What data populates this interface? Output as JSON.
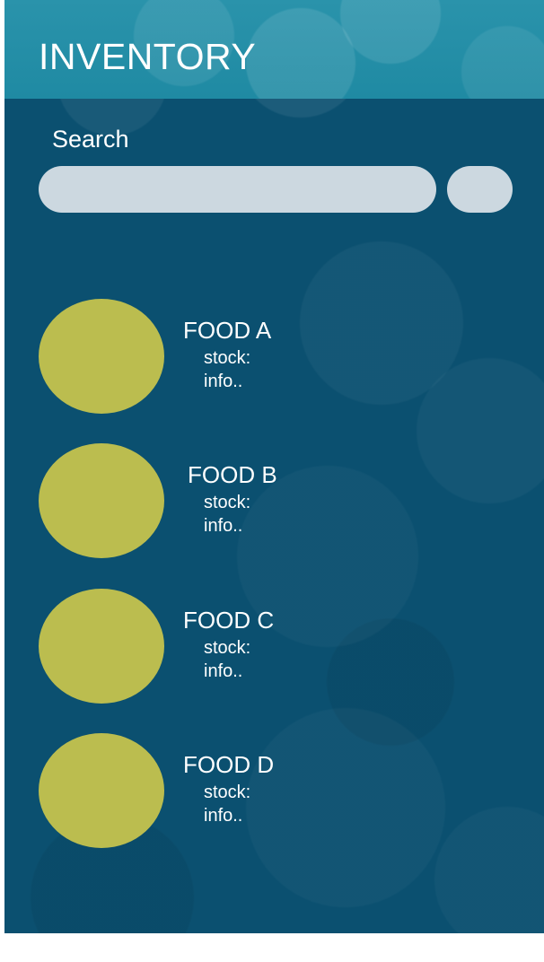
{
  "header": {
    "title": "INVENTORY"
  },
  "search": {
    "label": "Search",
    "placeholder": "",
    "value": "",
    "button_label": ""
  },
  "food_items": [
    {
      "name": "FOOD A",
      "stock_label": "stock:",
      "info_label": "info.."
    },
    {
      "name": "FOOD B",
      "stock_label": "stock:",
      "info_label": "info.."
    },
    {
      "name": "FOOD C",
      "stock_label": "stock:",
      "info_label": "info.."
    },
    {
      "name": "FOOD D",
      "stock_label": "stock:",
      "info_label": "info.."
    }
  ],
  "colors": {
    "header_bg": "#2a93ab",
    "screen_bg": "#0b5070",
    "search_field": "#ccd8e0",
    "food_thumb": "#bbbd4f",
    "text": "#ffffff"
  }
}
